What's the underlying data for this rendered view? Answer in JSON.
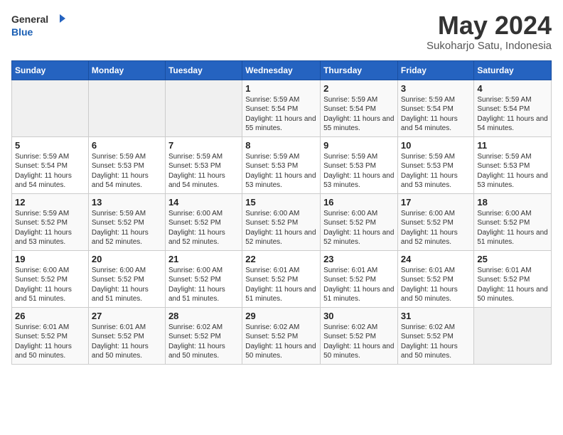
{
  "header": {
    "logo_line1": "General",
    "logo_line2": "Blue",
    "title": "May 2024",
    "subtitle": "Sukoharjo Satu, Indonesia"
  },
  "weekdays": [
    "Sunday",
    "Monday",
    "Tuesday",
    "Wednesday",
    "Thursday",
    "Friday",
    "Saturday"
  ],
  "weeks": [
    [
      {
        "day": "",
        "info": ""
      },
      {
        "day": "",
        "info": ""
      },
      {
        "day": "",
        "info": ""
      },
      {
        "day": "1",
        "info": "Sunrise: 5:59 AM\nSunset: 5:54 PM\nDaylight: 11 hours\nand 55 minutes."
      },
      {
        "day": "2",
        "info": "Sunrise: 5:59 AM\nSunset: 5:54 PM\nDaylight: 11 hours\nand 55 minutes."
      },
      {
        "day": "3",
        "info": "Sunrise: 5:59 AM\nSunset: 5:54 PM\nDaylight: 11 hours\nand 54 minutes."
      },
      {
        "day": "4",
        "info": "Sunrise: 5:59 AM\nSunset: 5:54 PM\nDaylight: 11 hours\nand 54 minutes."
      }
    ],
    [
      {
        "day": "5",
        "info": "Sunrise: 5:59 AM\nSunset: 5:54 PM\nDaylight: 11 hours\nand 54 minutes."
      },
      {
        "day": "6",
        "info": "Sunrise: 5:59 AM\nSunset: 5:53 PM\nDaylight: 11 hours\nand 54 minutes."
      },
      {
        "day": "7",
        "info": "Sunrise: 5:59 AM\nSunset: 5:53 PM\nDaylight: 11 hours\nand 54 minutes."
      },
      {
        "day": "8",
        "info": "Sunrise: 5:59 AM\nSunset: 5:53 PM\nDaylight: 11 hours\nand 53 minutes."
      },
      {
        "day": "9",
        "info": "Sunrise: 5:59 AM\nSunset: 5:53 PM\nDaylight: 11 hours\nand 53 minutes."
      },
      {
        "day": "10",
        "info": "Sunrise: 5:59 AM\nSunset: 5:53 PM\nDaylight: 11 hours\nand 53 minutes."
      },
      {
        "day": "11",
        "info": "Sunrise: 5:59 AM\nSunset: 5:53 PM\nDaylight: 11 hours\nand 53 minutes."
      }
    ],
    [
      {
        "day": "12",
        "info": "Sunrise: 5:59 AM\nSunset: 5:52 PM\nDaylight: 11 hours\nand 53 minutes."
      },
      {
        "day": "13",
        "info": "Sunrise: 5:59 AM\nSunset: 5:52 PM\nDaylight: 11 hours\nand 52 minutes."
      },
      {
        "day": "14",
        "info": "Sunrise: 6:00 AM\nSunset: 5:52 PM\nDaylight: 11 hours\nand 52 minutes."
      },
      {
        "day": "15",
        "info": "Sunrise: 6:00 AM\nSunset: 5:52 PM\nDaylight: 11 hours\nand 52 minutes."
      },
      {
        "day": "16",
        "info": "Sunrise: 6:00 AM\nSunset: 5:52 PM\nDaylight: 11 hours\nand 52 minutes."
      },
      {
        "day": "17",
        "info": "Sunrise: 6:00 AM\nSunset: 5:52 PM\nDaylight: 11 hours\nand 52 minutes."
      },
      {
        "day": "18",
        "info": "Sunrise: 6:00 AM\nSunset: 5:52 PM\nDaylight: 11 hours\nand 51 minutes."
      }
    ],
    [
      {
        "day": "19",
        "info": "Sunrise: 6:00 AM\nSunset: 5:52 PM\nDaylight: 11 hours\nand 51 minutes."
      },
      {
        "day": "20",
        "info": "Sunrise: 6:00 AM\nSunset: 5:52 PM\nDaylight: 11 hours\nand 51 minutes."
      },
      {
        "day": "21",
        "info": "Sunrise: 6:00 AM\nSunset: 5:52 PM\nDaylight: 11 hours\nand 51 minutes."
      },
      {
        "day": "22",
        "info": "Sunrise: 6:01 AM\nSunset: 5:52 PM\nDaylight: 11 hours\nand 51 minutes."
      },
      {
        "day": "23",
        "info": "Sunrise: 6:01 AM\nSunset: 5:52 PM\nDaylight: 11 hours\nand 51 minutes."
      },
      {
        "day": "24",
        "info": "Sunrise: 6:01 AM\nSunset: 5:52 PM\nDaylight: 11 hours\nand 50 minutes."
      },
      {
        "day": "25",
        "info": "Sunrise: 6:01 AM\nSunset: 5:52 PM\nDaylight: 11 hours\nand 50 minutes."
      }
    ],
    [
      {
        "day": "26",
        "info": "Sunrise: 6:01 AM\nSunset: 5:52 PM\nDaylight: 11 hours\nand 50 minutes."
      },
      {
        "day": "27",
        "info": "Sunrise: 6:01 AM\nSunset: 5:52 PM\nDaylight: 11 hours\nand 50 minutes."
      },
      {
        "day": "28",
        "info": "Sunrise: 6:02 AM\nSunset: 5:52 PM\nDaylight: 11 hours\nand 50 minutes."
      },
      {
        "day": "29",
        "info": "Sunrise: 6:02 AM\nSunset: 5:52 PM\nDaylight: 11 hours\nand 50 minutes."
      },
      {
        "day": "30",
        "info": "Sunrise: 6:02 AM\nSunset: 5:52 PM\nDaylight: 11 hours\nand 50 minutes."
      },
      {
        "day": "31",
        "info": "Sunrise: 6:02 AM\nSunset: 5:52 PM\nDaylight: 11 hours\nand 50 minutes."
      },
      {
        "day": "",
        "info": ""
      }
    ]
  ]
}
